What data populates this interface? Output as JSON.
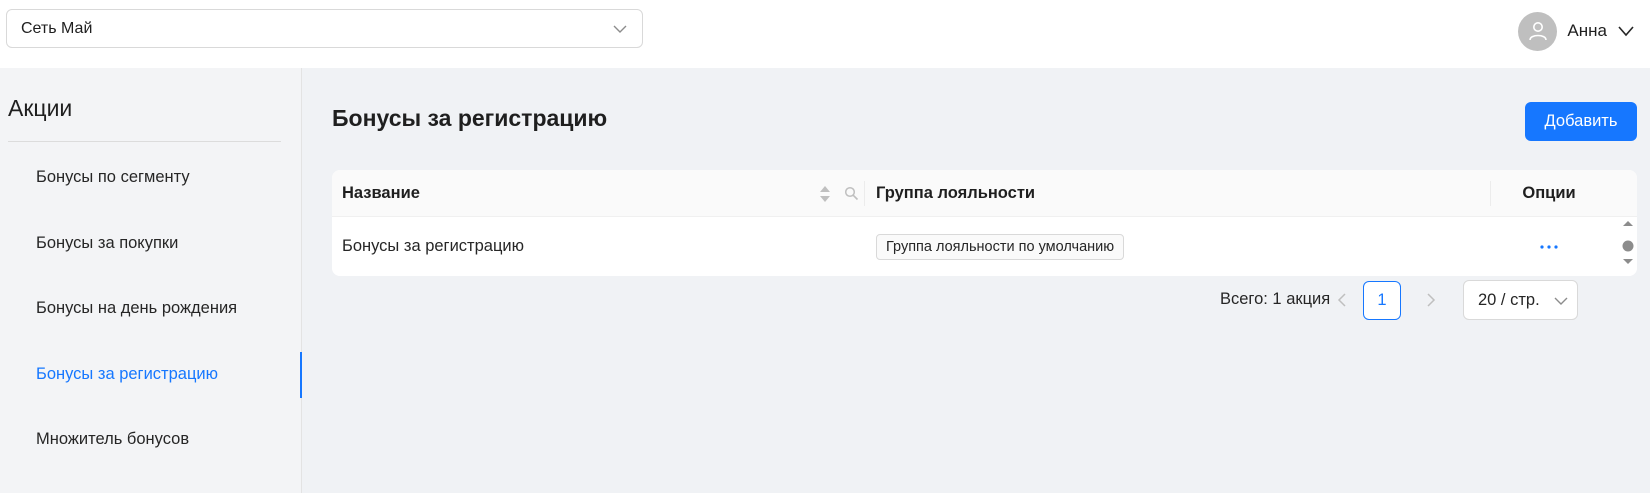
{
  "header": {
    "network_select": {
      "value": "Сеть Май"
    },
    "user": {
      "name": "Анна"
    }
  },
  "sidebar": {
    "title": "Акции",
    "items": [
      {
        "label": "Бонусы по сегменту",
        "active": false
      },
      {
        "label": "Бонусы за покупки",
        "active": false
      },
      {
        "label": "Бонусы на день рождения",
        "active": false
      },
      {
        "label": "Бонусы за регистрацию",
        "active": true
      },
      {
        "label": "Множитель бонусов",
        "active": false
      }
    ]
  },
  "main": {
    "title": "Бонусы за регистрацию",
    "add_label": "Добавить",
    "table": {
      "columns": {
        "name": "Название",
        "group": "Группа лояльности",
        "options": "Опции"
      },
      "rows": [
        {
          "name": "Бонусы за регистрацию",
          "group": "Группа лояльности по умолчанию"
        }
      ]
    },
    "pagination": {
      "total": "Всего: 1 акция",
      "current_page": "1",
      "page_size": "20 / стр."
    }
  },
  "colors": {
    "accent": "#1677ff",
    "sidebar_bg": "#f3f4f6",
    "main_bg": "#f0f2f5"
  },
  "icons": [
    "chevron-down-icon",
    "user-icon",
    "sort-icon",
    "search-icon",
    "more-icon",
    "chevron-left-icon",
    "chevron-right-icon"
  ]
}
